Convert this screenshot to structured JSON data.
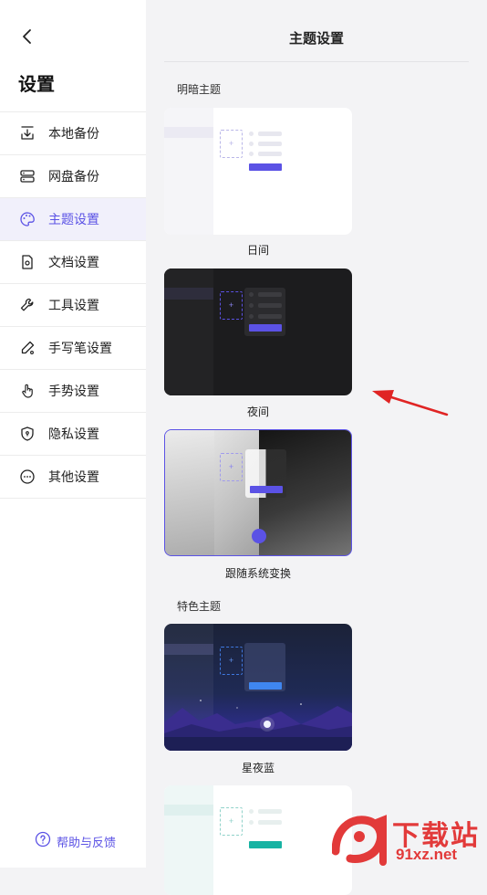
{
  "sidebar": {
    "title": "设置",
    "items": [
      {
        "label": "本地备份",
        "icon": "local-backup-icon"
      },
      {
        "label": "网盘备份",
        "icon": "cloud-drive-icon"
      },
      {
        "label": "主题设置",
        "icon": "palette-icon",
        "active": true
      },
      {
        "label": "文档设置",
        "icon": "document-settings-icon"
      },
      {
        "label": "工具设置",
        "icon": "wrench-icon"
      },
      {
        "label": "手写笔设置",
        "icon": "pen-icon"
      },
      {
        "label": "手势设置",
        "icon": "gesture-hand-icon"
      },
      {
        "label": "隐私设置",
        "icon": "shield-lock-icon"
      },
      {
        "label": "其他设置",
        "icon": "more-dots-icon"
      }
    ],
    "help": "帮助与反馈"
  },
  "main": {
    "title": "主题设置",
    "section_light_dark": "明暗主题",
    "section_featured": "特色主题",
    "themes": [
      {
        "label": "日间"
      },
      {
        "label": "夜间"
      },
      {
        "label": "跟随系统变换",
        "selected": true
      },
      {
        "label": "星夜蓝"
      }
    ]
  },
  "colors": {
    "accent": "#5b52e5",
    "sidebar_bg": "#ffffff",
    "main_bg": "#f3f3f5",
    "arrow": "#e02424"
  },
  "watermark": {
    "logo_text": "9",
    "brand": "下载站",
    "domain": "91xz.net"
  }
}
